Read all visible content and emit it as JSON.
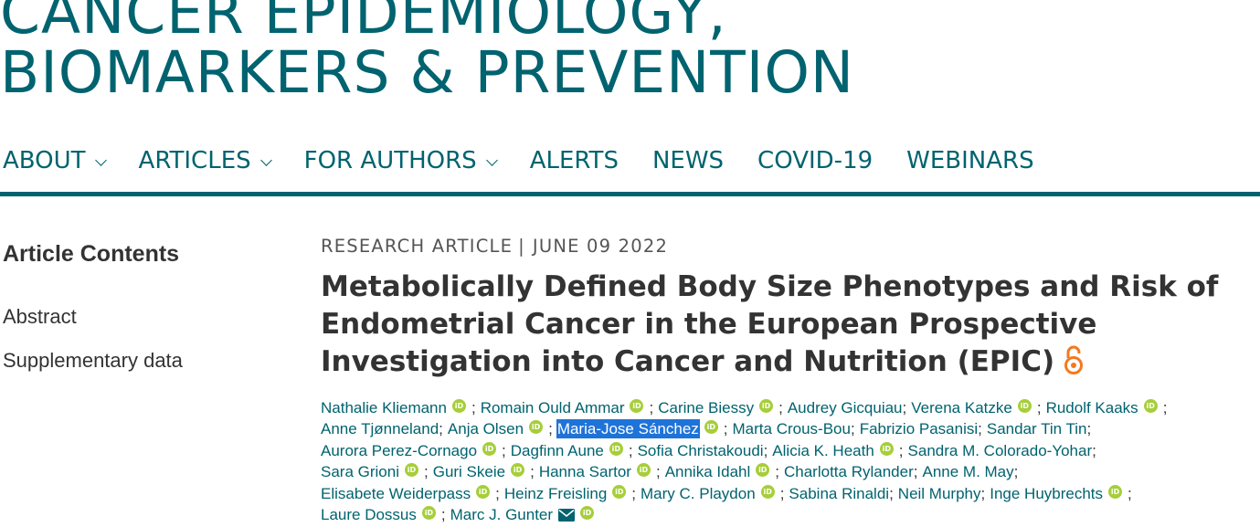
{
  "journal": {
    "title_line1": "CANCER EPIDEMIOLOGY,",
    "title_line2": "BIOMARKERS & PREVENTION"
  },
  "nav": {
    "items": [
      {
        "label": "ABOUT",
        "dropdown": true
      },
      {
        "label": "ARTICLES",
        "dropdown": true
      },
      {
        "label": "FOR AUTHORS",
        "dropdown": true
      },
      {
        "label": "ALERTS",
        "dropdown": false
      },
      {
        "label": "NEWS",
        "dropdown": false
      },
      {
        "label": "COVID-19",
        "dropdown": false
      },
      {
        "label": "WEBINARS",
        "dropdown": false
      }
    ]
  },
  "sidebar": {
    "heading": "Article Contents",
    "links": [
      "Abstract",
      "Supplementary data"
    ]
  },
  "article": {
    "type": "RESEARCH ARTICLE",
    "separator": "|",
    "date": "JUNE 09 2022",
    "title": "Metabolically Defined Body Size Phenotypes and Risk of Endometrial Cancer in the European Prospective Investigation into Cancer and Nutrition (EPIC)",
    "open_access_icon": "open-access-lock-icon",
    "orcid_label": "iD",
    "selected_author": "Maria-Jose Sánchez",
    "author_lines": [
      [
        {
          "name": "Nathalie Kliemann",
          "orcid": true
        },
        {
          "name": "Romain Ould Ammar",
          "orcid": true
        },
        {
          "name": "Carine Biessy",
          "orcid": true
        },
        {
          "name": "Audrey Gicquiau",
          "orcid": false
        },
        {
          "name": "Verena Katzke",
          "orcid": true
        },
        {
          "name": "Rudolf Kaaks",
          "orcid": true
        }
      ],
      [
        {
          "name": "Anne Tjønneland",
          "orcid": false
        },
        {
          "name": "Anja Olsen",
          "orcid": true
        },
        {
          "name": "Maria-Jose Sánchez",
          "orcid": true,
          "selected": true
        },
        {
          "name": "Marta Crous-Bou",
          "orcid": false
        },
        {
          "name": "Fabrizio Pasanisi",
          "orcid": false
        },
        {
          "name": "Sandar Tin Tin",
          "orcid": false
        }
      ],
      [
        {
          "name": "Aurora Perez-Cornago",
          "orcid": true
        },
        {
          "name": "Dagfinn Aune",
          "orcid": true
        },
        {
          "name": "Sofia Christakoudi",
          "orcid": false
        },
        {
          "name": "Alicia K. Heath",
          "orcid": true
        },
        {
          "name": "Sandra M. Colorado-Yohar",
          "orcid": false
        }
      ],
      [
        {
          "name": "Sara Grioni",
          "orcid": true
        },
        {
          "name": "Guri Skeie",
          "orcid": true
        },
        {
          "name": "Hanna Sartor",
          "orcid": true
        },
        {
          "name": "Annika Idahl",
          "orcid": true
        },
        {
          "name": "Charlotta Rylander",
          "orcid": false
        },
        {
          "name": "Anne M. May",
          "orcid": false
        }
      ],
      [
        {
          "name": "Elisabete Weiderpass",
          "orcid": true
        },
        {
          "name": "Heinz Freisling",
          "orcid": true
        },
        {
          "name": "Mary C. Playdon",
          "orcid": true
        },
        {
          "name": "Sabina Rinaldi",
          "orcid": false
        },
        {
          "name": "Neil Murphy",
          "orcid": false
        },
        {
          "name": "Inge Huybrechts",
          "orcid": true
        }
      ],
      [
        {
          "name": "Laure Dossus",
          "orcid": true
        },
        {
          "name": "Marc J. Gunter",
          "orcid": true,
          "email": true,
          "last": true
        }
      ]
    ]
  },
  "colors": {
    "brand_teal": "#00636f",
    "orcid_green": "#a6ce39",
    "open_access_orange": "#f47920",
    "selection_blue": "#1e73d8"
  },
  "icons": {
    "dropdown": "chevron-down-icon",
    "orcid": "orcid-icon",
    "email": "envelope-icon"
  }
}
